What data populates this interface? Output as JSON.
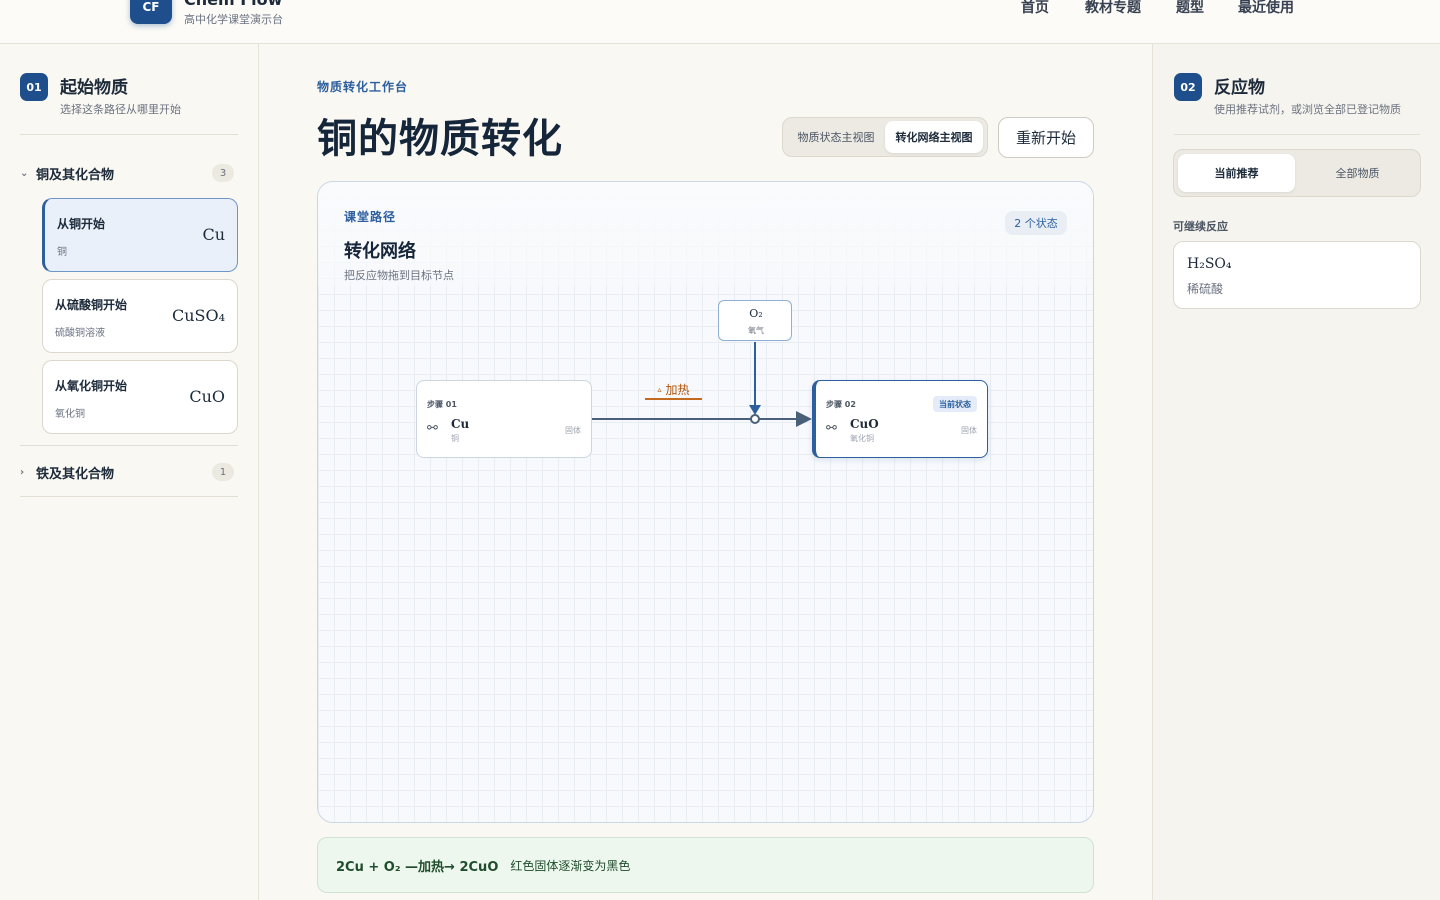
{
  "header": {
    "logo_text": "CF",
    "brand": "Chem Flow",
    "brand_sub": "高中化学课堂演示台",
    "nav": [
      "首页",
      "教材专题",
      "题型",
      "最近使用"
    ]
  },
  "left": {
    "step": "01",
    "title": "起始物质",
    "subtitle": "选择这条路径从哪里开始",
    "groups": [
      {
        "label": "铜及其化合物",
        "count": "3",
        "expanded": true
      },
      {
        "label": "铁及其化合物",
        "count": "1",
        "expanded": false
      }
    ],
    "starts": [
      {
        "title": "从铜开始",
        "sub": "铜",
        "formula": "Cu",
        "active": true
      },
      {
        "title": "从硫酸铜开始",
        "sub": "硫酸铜溶液",
        "formula": "CuSO₄",
        "active": false
      },
      {
        "title": "从氧化铜开始",
        "sub": "氧化铜",
        "formula": "CuO",
        "active": false
      }
    ]
  },
  "main": {
    "crumb": "物质转化工作台",
    "title": "铜的物质转化",
    "view_options": [
      "物质状态主视图",
      "转化网络主视图"
    ],
    "active_view": "转化网络主视图",
    "restart": "重新开始",
    "canvas": {
      "label": "课堂路径",
      "title": "转化网络",
      "subtitle": "把反应物拖到目标节点",
      "state_count": "2 个状态",
      "nodes": [
        {
          "step": "步骤 01",
          "formula": "Cu",
          "name": "铜",
          "state": "固体",
          "current": false
        },
        {
          "step": "步骤 02",
          "formula": "CuO",
          "name": "氧化铜",
          "state": "固体",
          "current": true,
          "tag": "当前状态"
        }
      ],
      "reagent_node": {
        "formula": "O₂",
        "name": "氧气"
      },
      "condition": "加热"
    },
    "equation": {
      "text": "2Cu + O₂ —加热→ 2CuO",
      "description": "红色固体逐渐变为黑色"
    }
  },
  "right": {
    "step": "02",
    "title": "反应物",
    "subtitle": "使用推荐试剂，或浏览全部已登记物质",
    "tabs": [
      "当前推荐",
      "全部物质"
    ],
    "active_tab": "当前推荐",
    "section": "可继续反应",
    "reagents": [
      {
        "formula": "H₂SO₄",
        "name": "稀硫酸"
      }
    ]
  },
  "colors": {
    "accent": "#1e4f8c",
    "heat": "#c46a1e",
    "equation_bg": "#eef7ee"
  }
}
